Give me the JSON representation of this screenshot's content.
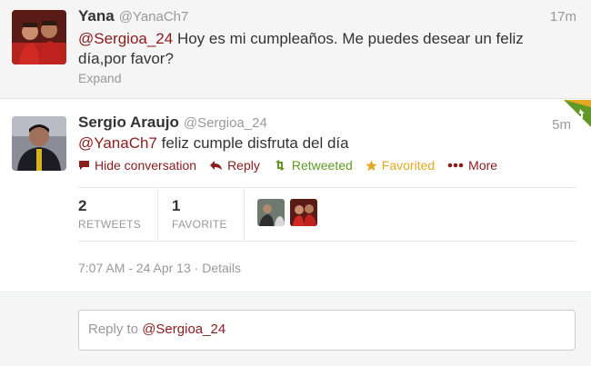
{
  "tweet1": {
    "name": "Yana",
    "handle": "@YanaCh7",
    "time": "17m",
    "mention": "@Sergioa_24",
    "text_line1": " Hoy es mi cumpleaños. Me puedes desear un feliz",
    "text_line2": "día,por favor?",
    "expand_label": "Expand"
  },
  "tweet2": {
    "name": "Sergio Araujo",
    "handle": "@Sergioa_24",
    "time": "5m",
    "mention": "@YanaCh7",
    "text": " feliz cumple disfruta del día",
    "actions": {
      "hide": "Hide conversation",
      "reply": "Reply",
      "retweeted": "Retweeted",
      "favorited": "Favorited",
      "more": "More"
    },
    "stats": {
      "retweets_count": "2",
      "retweets_label": "RETWEETS",
      "favorites_count": "1",
      "favorites_label": "FAVORITE"
    },
    "timestamp": "7:07 AM - 24 Apr 13",
    "details_sep": " · ",
    "details_label": "Details"
  },
  "reply": {
    "prefix": "Reply to ",
    "mention": "@Sergioa_24"
  },
  "colors": {
    "mention": "#8a1c1c",
    "retweeted": "#609928",
    "favorited": "#e4a823",
    "muted": "#999999"
  },
  "icons": [
    "speech-bubble-icon",
    "reply-arrow-icon",
    "retweet-icon",
    "star-icon",
    "more-dots-icon",
    "retweet-corner-icon"
  ]
}
